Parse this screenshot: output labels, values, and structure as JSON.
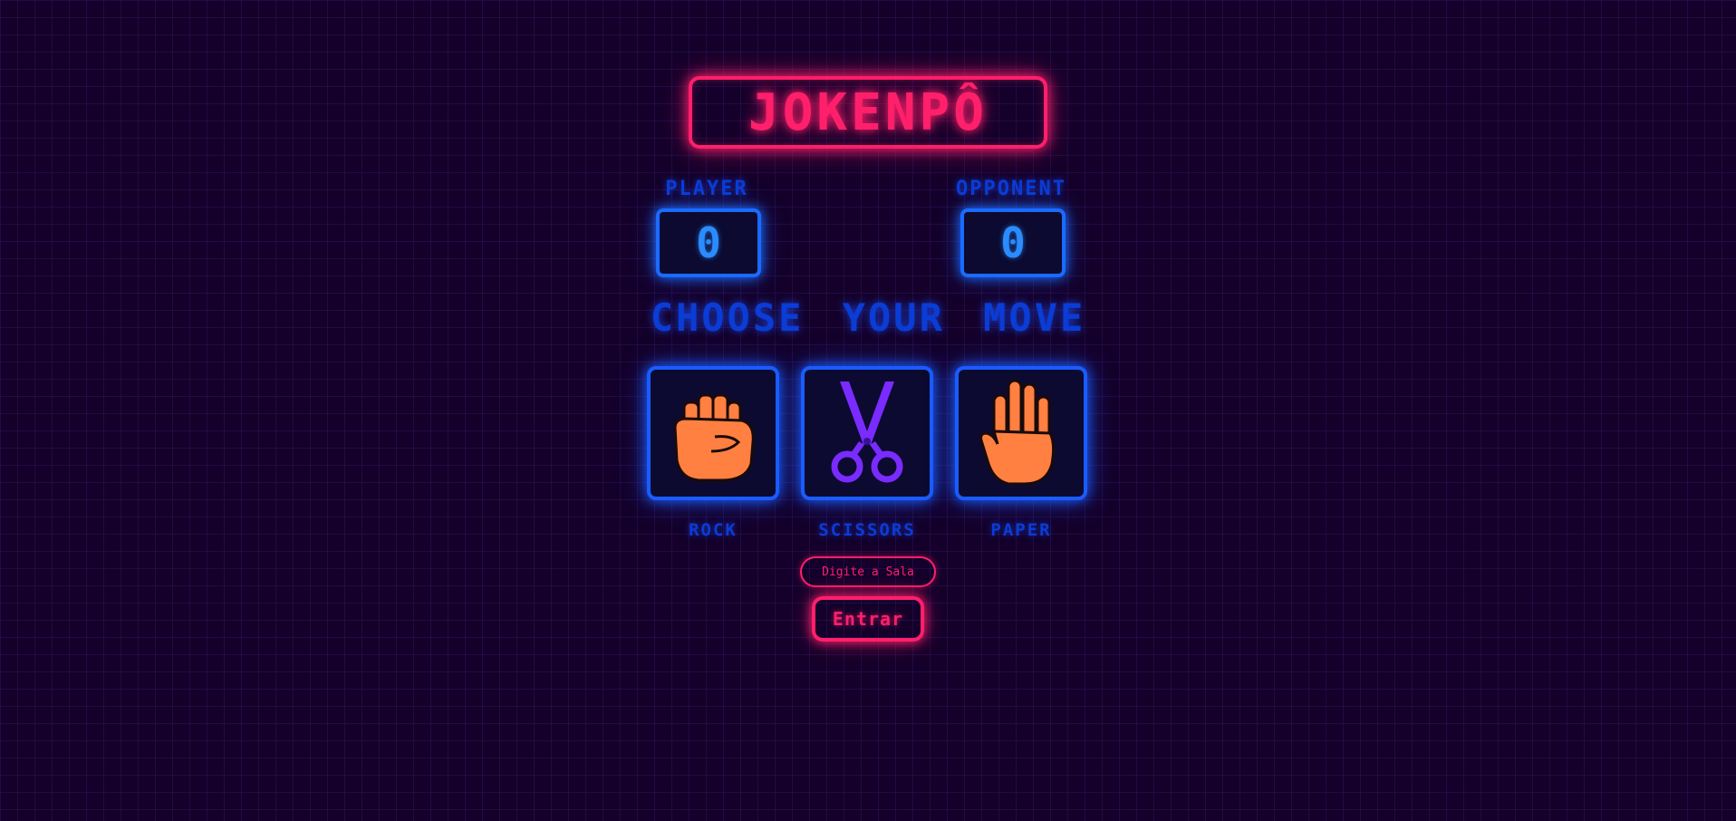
{
  "title": "JOKENPÔ",
  "scoreboard": {
    "player_label": "PLAYER",
    "player_score": "0",
    "opponent_label": "OPPONENT",
    "opponent_score": "0"
  },
  "prompt": "CHOOSE YOUR MOVE",
  "moves": [
    {
      "label": "ROCK",
      "icon": "fist-icon",
      "color": "#ff8040"
    },
    {
      "label": "SCISSORS",
      "icon": "scissors-icon",
      "color": "#7a2bff"
    },
    {
      "label": "PAPER",
      "icon": "hand-icon",
      "color": "#ff8040"
    }
  ],
  "room": {
    "placeholder": "Digite a Sala",
    "enter_label": "Entrar"
  },
  "colors": {
    "background": "#14002a",
    "neon_pink": "#ff1f6b",
    "neon_blue": "#1a5cff"
  }
}
